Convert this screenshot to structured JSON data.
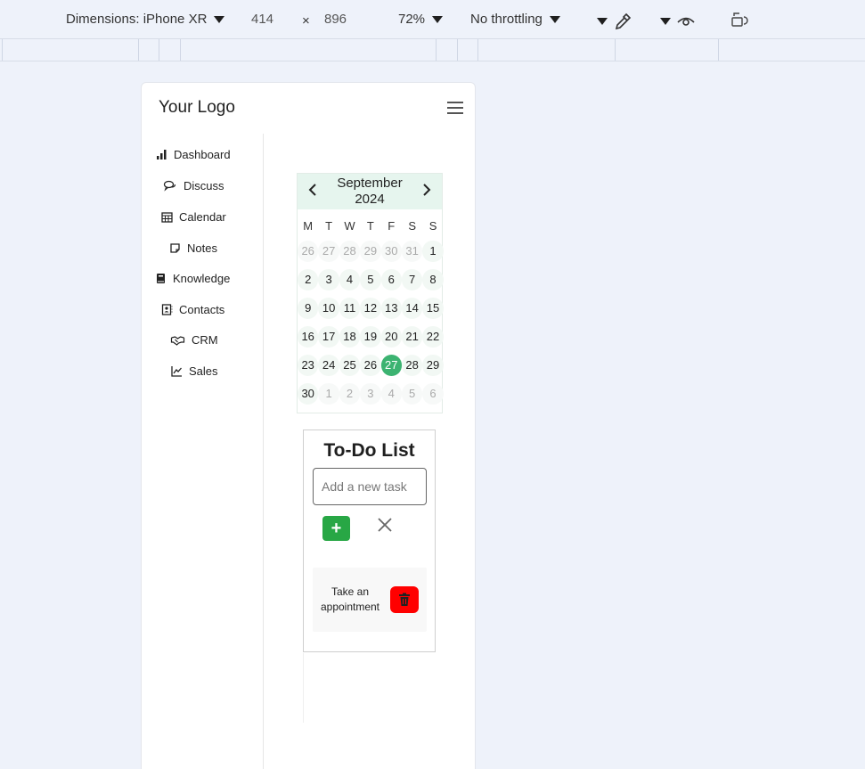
{
  "devtools": {
    "dimensions_label": "Dimensions: iPhone XR",
    "width": "414",
    "times": "×",
    "height": "896",
    "zoom": "72%",
    "throttling": "No throttling"
  },
  "app": {
    "logo": "Your Logo",
    "nav": [
      {
        "label": "Dashboard",
        "icon": "bar-chart-icon"
      },
      {
        "label": "Discuss",
        "icon": "chat-bubbles-icon"
      },
      {
        "label": "Calendar",
        "icon": "calendar-icon"
      },
      {
        "label": "Notes",
        "icon": "note-icon"
      },
      {
        "label": "Knowledge",
        "icon": "book-icon"
      },
      {
        "label": "Contacts",
        "icon": "contact-card-icon"
      },
      {
        "label": "CRM",
        "icon": "handshake-icon"
      },
      {
        "label": "Sales",
        "icon": "line-chart-icon"
      }
    ]
  },
  "calendar": {
    "month": "September",
    "year": "2024",
    "prev": "‹",
    "next": "›",
    "weekdays": [
      "M",
      "T",
      "W",
      "T",
      "F",
      "S",
      "S"
    ],
    "weeks": [
      [
        "26",
        "27",
        "28",
        "29",
        "30",
        "31",
        "1"
      ],
      [
        "2",
        "3",
        "4",
        "5",
        "6",
        "7",
        "8"
      ],
      [
        "9",
        "10",
        "11",
        "12",
        "13",
        "14",
        "15"
      ],
      [
        "16",
        "17",
        "18",
        "19",
        "20",
        "21",
        "22"
      ],
      [
        "23",
        "24",
        "25",
        "26",
        "27",
        "28",
        "29"
      ],
      [
        "30",
        "1",
        "2",
        "3",
        "4",
        "5",
        "6"
      ]
    ],
    "today": "27"
  },
  "todo": {
    "title": "To-Do List",
    "placeholder": "Add a new task",
    "add_label": "+",
    "tasks": [
      {
        "text": "Take an appointment"
      }
    ]
  }
}
